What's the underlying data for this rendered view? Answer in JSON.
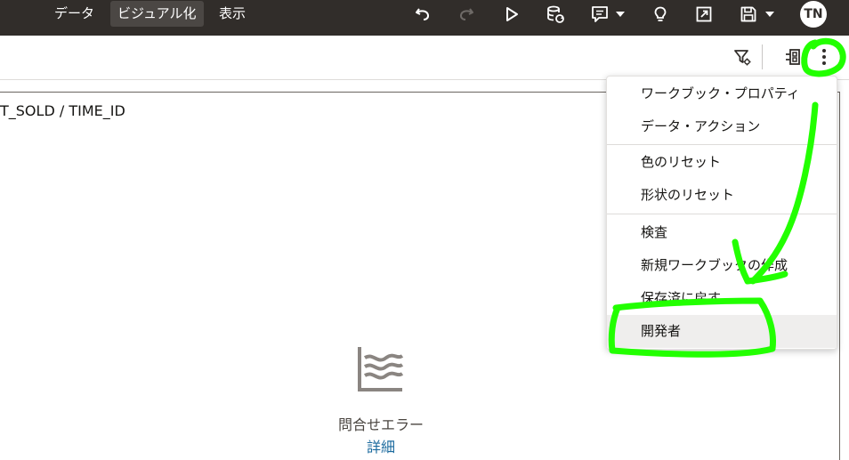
{
  "topbar": {
    "tabs": [
      {
        "label": "データ",
        "active": false
      },
      {
        "label": "ビジュアル化",
        "active": true
      },
      {
        "label": "表示",
        "active": false
      }
    ],
    "icons": [
      "undo-icon",
      "redo-icon",
      "play-icon",
      "refresh-data-icon",
      "narrate-icon",
      "lightbulb-icon",
      "present-icon",
      "save-icon"
    ],
    "user_initials": "TN"
  },
  "toolbar": {
    "icons": [
      "filter-settings-icon",
      "data-panel-icon",
      "more-options-icon"
    ]
  },
  "canvas": {
    "viz_title": "T_SOLD / TIME_ID",
    "error_text": "問合せエラー",
    "error_link": "詳細"
  },
  "menu": {
    "groups": [
      [
        "ワークブック・プロパティ",
        "データ・アクション"
      ],
      [
        "色のリセット",
        "形状のリセット"
      ],
      [
        "検査",
        "新規ワークブックの作成",
        "保存済に戻す",
        "開発者"
      ]
    ],
    "highlighted": "開発者"
  },
  "colors": {
    "topbar_bg": "#312d2a",
    "active_tab_bg": "#4b4744",
    "link": "#1b6a9e",
    "annotation": "#22ff00"
  }
}
